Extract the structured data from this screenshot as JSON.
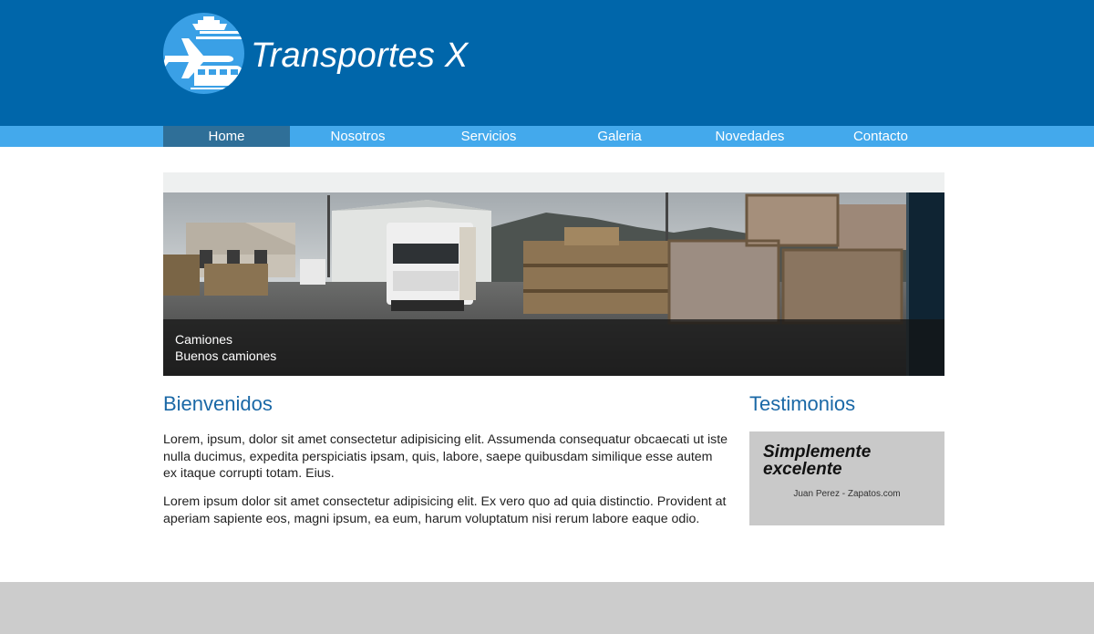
{
  "header": {
    "brand_name": "Transportes X",
    "logo_icon": "plane-ship-train-logo-icon",
    "background_color": "#0066aa"
  },
  "nav": {
    "items": [
      {
        "label": "Home",
        "active": true
      },
      {
        "label": "Nosotros",
        "active": false
      },
      {
        "label": "Servicios",
        "active": false
      },
      {
        "label": "Galeria",
        "active": false
      },
      {
        "label": "Novedades",
        "active": false
      },
      {
        "label": "Contacto",
        "active": false
      }
    ],
    "background_color": "#43a9ec",
    "active_color": "#2f6f98"
  },
  "slider": {
    "image": "warehouse-trucks-and-crates-photo",
    "caption_title": "Camiones",
    "caption_subtitle": "Buenos camiones"
  },
  "main": {
    "title": "Bienvenidos",
    "paragraphs": [
      "Lorem, ipsum, dolor sit amet consectetur adipisicing elit. Assumenda consequatur obcaecati ut iste nulla ducimus, expedita perspiciatis ipsam, quis, labore, saepe quibusdam similique esse autem ex itaque corrupti totam. Eius.",
      "Lorem ipsum dolor sit amet consectetur adipisicing elit. Ex vero quo ad quia distinctio. Provident at aperiam sapiente eos, magni ipsum, ea eum, harum voluptatum nisi rerum labore eaque odio."
    ]
  },
  "testimonials": {
    "title": "Testimonios",
    "quote": "Simplemente excelente",
    "author": "Juan Perez - Zapatos.com"
  },
  "colors": {
    "heading": "#1a68a6",
    "footer": "#cccccc"
  }
}
